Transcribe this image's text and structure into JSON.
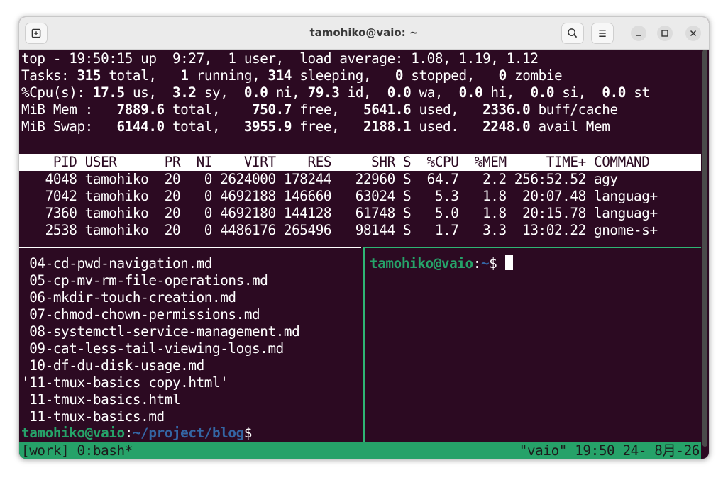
{
  "window": {
    "title": "tamohiko@vaio: ~"
  },
  "icons": {
    "new_tab": "new-tab-icon",
    "search": "search-icon",
    "menu": "hamburger-menu-icon",
    "minimize": "minimize-icon",
    "maximize": "maximize-icon",
    "close": "close-icon"
  },
  "top": {
    "line1": "top - 19:50:15 up  9:27,  1 user,  load average: 1.08, 1.19, 1.12",
    "tasks": {
      "label": "Tasks:",
      "total": "315",
      "total_label": " total,",
      "running": "1",
      "running_label": " running,",
      "sleeping": "314",
      "sleeping_label": " sleeping,",
      "stopped": "0",
      "stopped_label": " stopped,",
      "zombie": "0",
      "zombie_label": " zombie"
    },
    "cpu": {
      "label": "%Cpu(s):",
      "us": "17.5",
      "us_label": " us,",
      "sy": "3.2",
      "sy_label": " sy,",
      "ni": "0.0",
      "ni_label": " ni,",
      "id": "79.3",
      "id_label": " id,",
      "wa": "0.0",
      "wa_label": " wa,",
      "hi": "0.0",
      "hi_label": " hi,",
      "si": "0.0",
      "si_label": " si,",
      "st": "0.0",
      "st_label": " st"
    },
    "mem": {
      "label": "MiB Mem :",
      "total": "7889.6",
      "total_label": " total,",
      "free": "750.7",
      "free_label": " free,",
      "used": "5641.6",
      "used_label": " used,",
      "cache": "2336.0",
      "cache_label": " buff/cache"
    },
    "swap": {
      "label": "MiB Swap:",
      "total": "6144.0",
      "total_label": " total,",
      "free": "3955.9",
      "free_label": " free,",
      "used": "2188.1",
      "used_label": " used.",
      "avail": "2248.0",
      "avail_label": " avail Mem"
    },
    "columns": [
      "PID",
      "USER",
      "PR",
      "NI",
      "VIRT",
      "RES",
      "SHR",
      "S",
      "%CPU",
      "%MEM",
      "TIME+",
      "COMMAND"
    ],
    "processes": [
      [
        "4048",
        "tamohiko",
        "20",
        "0",
        "2624000",
        "178244",
        "22960",
        "S",
        "64.7",
        "2.2",
        "256:52.52",
        "agy"
      ],
      [
        "7042",
        "tamohiko",
        "20",
        "0",
        "4692188",
        "146660",
        "63024",
        "S",
        "5.3",
        "1.8",
        "20:07.48",
        "languag+"
      ],
      [
        "7360",
        "tamohiko",
        "20",
        "0",
        "4692180",
        "144128",
        "61748",
        "S",
        "5.0",
        "1.8",
        "20:15.78",
        "languag+"
      ],
      [
        "2538",
        "tamohiko",
        "20",
        "0",
        "4486176",
        "265496",
        "98144",
        "S",
        "1.7",
        "3.3",
        "13:02.22",
        "gnome-s+"
      ]
    ]
  },
  "left_pane": {
    "files": [
      " 04-cd-pwd-navigation.md",
      " 05-cp-mv-rm-file-operations.md",
      " 06-mkdir-touch-creation.md",
      " 07-chmod-chown-permissions.md",
      " 08-systemctl-service-management.md",
      " 09-cat-less-tail-viewing-logs.md",
      " 10-df-du-disk-usage.md",
      "'11-tmux-basics copy.html'",
      " 11-tmux-basics.html",
      " 11-tmux-basics.md"
    ],
    "prompt_user": "tamohiko@vaio",
    "prompt_sep": ":",
    "prompt_path": "~/project/blog",
    "prompt_symbol": "$"
  },
  "right_pane": {
    "prompt_user": "tamohiko@vaio",
    "prompt_sep": ":",
    "prompt_path": "~",
    "prompt_symbol": "$ "
  },
  "status": {
    "left": "[work] 0:bash*",
    "right": "\"vaio\" 19:50 24- 8月-26"
  },
  "colors": {
    "terminal_bg": "#2c0a22",
    "prompt_green": "#26a269",
    "path_blue": "#3465a4",
    "statusbar_bg": "#26a269"
  }
}
